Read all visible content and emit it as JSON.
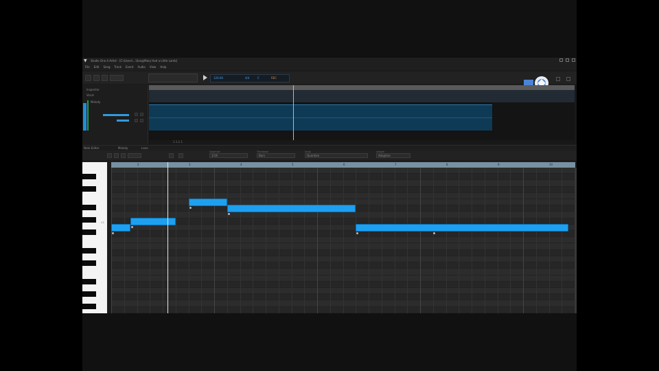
{
  "app": {
    "title": "Studio One 4 Artist - [C:\\Users\\...\\Song\\Mary Had a Little Lamb]",
    "menu": [
      "File",
      "Edit",
      "Song",
      "Track",
      "Event",
      "Audio",
      "View",
      "Help"
    ]
  },
  "transport": {
    "tempo": "120.00",
    "time_signature": "4/4",
    "key": "C",
    "record": "REC"
  },
  "arrange": {
    "track_name": "Vocal",
    "lane_label": "Melody",
    "inspector_label": "Inspector",
    "footer_label": "1.1.1.1"
  },
  "editor": {
    "tabs": [
      "Note Editor",
      "Melody",
      "Lane"
    ],
    "toolbar_fields": [
      {
        "caption": "Quantize",
        "value": "1/16"
      },
      {
        "caption": "Timebase",
        "value": "Bars"
      },
      {
        "caption": "Snap",
        "value": "Quantize"
      },
      {
        "caption": "Length",
        "value": "Adaptive"
      }
    ],
    "bar_numbers": [
      "2",
      "3",
      "4",
      "5",
      "6",
      "7",
      "8",
      "9",
      "10"
    ],
    "keyboard_label": "C4"
  },
  "piano_roll": {
    "rows": 23,
    "notes": [
      {
        "row": 9,
        "start_beat": 0.0,
        "length_beats": 0.75
      },
      {
        "row": 8,
        "start_beat": 0.75,
        "length_beats": 1.75
      },
      {
        "row": 5,
        "start_beat": 3.0,
        "length_beats": 1.5
      },
      {
        "row": 6,
        "start_beat": 4.5,
        "length_beats": 5.0
      },
      {
        "row": 9,
        "start_beat": 9.5,
        "length_beats": 8.25
      }
    ]
  },
  "colors": {
    "note_fill": "#1ea0f0",
    "clip_fill": "#0f3a55",
    "ruler": "#7891a2",
    "background": "#2c2c2c"
  }
}
